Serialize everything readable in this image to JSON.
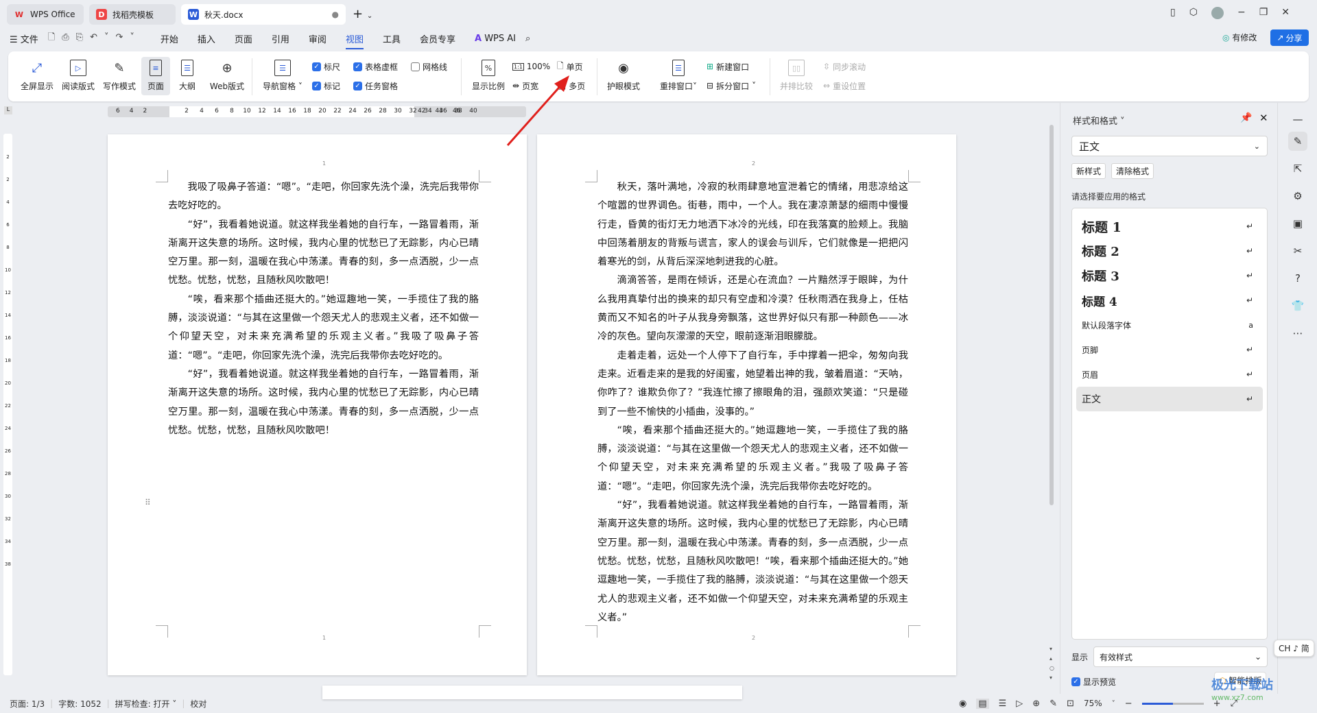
{
  "tabs": [
    {
      "label": "WPS Office",
      "icon": "W"
    },
    {
      "label": "找稻壳模板",
      "icon": "D"
    },
    {
      "label": "秋天.docx",
      "icon": "W"
    }
  ],
  "menu": {
    "file": "文件",
    "items": [
      "开始",
      "插入",
      "页面",
      "引用",
      "审阅",
      "视图",
      "工具",
      "会员专享"
    ],
    "active": "视图",
    "ai": "WPS AI",
    "modified": "有修改",
    "share": "分享"
  },
  "ribbon": {
    "views": [
      "全屏显示",
      "阅读版式",
      "写作模式",
      "页面",
      "大纲",
      "Web版式"
    ],
    "nav": "导航窗格",
    "checks": [
      {
        "label": "标尺",
        "checked": true
      },
      {
        "label": "表格虚框",
        "checked": true
      },
      {
        "label": "网格线",
        "checked": false
      },
      {
        "label": "标记",
        "checked": true
      },
      {
        "label": "任务窗格",
        "checked": true
      }
    ],
    "zoom": "显示比例",
    "zoom100": "100%",
    "single": "单页",
    "width": "页宽",
    "multi": "多页",
    "eye": "护眼模式",
    "rearrange": "重排窗口",
    "newwin": "新建窗口",
    "split": "拆分窗口",
    "compare": "并排比较",
    "sync": "同步滚动",
    "reset": "重设位置"
  },
  "ruler": {
    "left": [
      "6",
      "4",
      "2"
    ],
    "main": [
      "2",
      "4",
      "6",
      "8",
      "10",
      "12",
      "14",
      "16",
      "18",
      "20",
      "22",
      "24",
      "26",
      "28",
      "30",
      "32",
      "34",
      "36",
      "38",
      "40"
    ],
    "right": [
      "42",
      "44",
      "46"
    ]
  },
  "vruler": [
    "2",
    "2",
    "4",
    "6",
    "8",
    "10",
    "12",
    "14",
    "16",
    "18",
    "20",
    "22",
    "24",
    "26",
    "28",
    "30",
    "32",
    "34",
    "38"
  ],
  "page1": {
    "num": "1",
    "paragraphs": [
      "我吸了吸鼻子答道：“嗯”。“走吧，你回家先洗个澡，洗完后我带你去吃好吃的。",
      "“好”，我看着她说道。就这样我坐着她的自行车，一路冒着雨，渐渐离开这失意的场所。这时候，我内心里的忧愁已了无踪影，内心已晴空万里。那一刻，温暖在我心中荡漾。青春的刻，多一点洒脱，少一点忧愁。忧愁，忧愁，且随秋风吹散吧！",
      "“唉，看来那个插曲还挺大的。”她逗趣地一笑，一手揽住了我的胳膊，淡淡说道：“与其在这里做一个怨天尤人的悲观主义者，还不如做一个仰望天空，对未来充满希望的乐观主义者。”我吸了吸鼻子答道：“嗯”。“走吧，你回家先洗个澡，洗完后我带你去吃好吃的。",
      "“好”，我看着她说道。就这样我坐着她的自行车，一路冒着雨，渐渐离开这失意的场所。这时候，我内心里的忧愁已了无踪影，内心已晴空万里。那一刻，温暖在我心中荡漾。青春的刻，多一点洒脱，少一点忧愁。忧愁，忧愁，且随秋风吹散吧！"
    ]
  },
  "page2": {
    "num": "2",
    "paragraphs": [
      "秋天，落叶满地，冷寂的秋雨肆意地宣泄着它的情绪，用悲凉给这个喧嚣的世界调色。街巷，雨中，一个人。我在凄凉萧瑟的细雨中慢慢行走，昏黄的街灯无力地洒下冰冷的光线，印在我落寞的脸颊上。我脑中回荡着朋友的背叛与谎言，家人的误会与训斥，它们就像是一把把闪着寒光的剑，从背后深深地刺进我的心脏。",
      "滴滴答答，是雨在倾诉，还是心在流血？一片黯然浮于眼眸，为什么我用真挚付出的换来的却只有空虚和冷漠？任秋雨洒在我身上，任枯黄而又不知名的叶子从我身旁飘落，这世界好似只有那一种颜色——冰冷的灰色。望向灰濛濛的天空，眼前逐渐泪眼朦胧。",
      "走着走着，远处一个人停下了自行车，手中撑着一把伞，匆匆向我走来。近看走来的是我的好闺蜜，她望着出神的我，皱着眉道：“天呐，你咋了？谁欺负你了？”我连忙擦了擦眼角的泪，强颜欢笑道：“只是碰到了一些不愉快的小插曲，没事的。”",
      "“唉，看来那个插曲还挺大的。”她逗趣地一笑，一手揽住了我的胳膊，淡淡说道：“与其在这里做一个怨天尤人的悲观主义者，还不如做一个仰望天空，对未来充满希望的乐观主义者。”我吸了吸鼻子答道：“嗯”。“走吧，你回家先洗个澡，洗完后我带你去吃好吃的。",
      "“好”，我看着她说道。就这样我坐着她的自行车，一路冒着雨，渐渐离开这失意的场所。这时候，我内心里的忧愁已了无踪影，内心已晴空万里。那一刻，温暖在我心中荡漾。青春的刻，多一点洒脱，少一点忧愁。忧愁，忧愁，且随秋风吹散吧！“唉，看来那个插曲还挺大的。”她逗趣地一笑，一手揽住了我的胳膊，淡淡说道：“与其在这里做一个怨天尤人的悲观主义者，还不如做一个仰望天空，对未来充满希望的乐观主义者。”"
    ]
  },
  "panel": {
    "title": "样式和格式",
    "current": "正文",
    "new_style": "新样式",
    "clear": "清除格式",
    "prompt": "请选择要应用的格式",
    "styles": [
      "标题 1",
      "标题 2",
      "标题 3",
      "标题 4",
      "默认段落字体",
      "页脚",
      "页眉",
      "正文"
    ],
    "show_label": "显示",
    "show_value": "有效样式",
    "preview": "显示预览",
    "smart": "智能排版"
  },
  "ime": "CH ♪ 简",
  "status": {
    "page": "页面: 1/3",
    "words": "字数: 1052",
    "spell": "拼写检查: 打开",
    "proof": "校对",
    "zoom": "75%",
    "zoom_fraction": 0.5
  },
  "watermark": {
    "text": "极光下载站",
    "url": "www.xz7.com"
  },
  "colors": {
    "accent": "#2b5bd7",
    "share": "#1f6fe5",
    "arrow": "#e0201c"
  }
}
